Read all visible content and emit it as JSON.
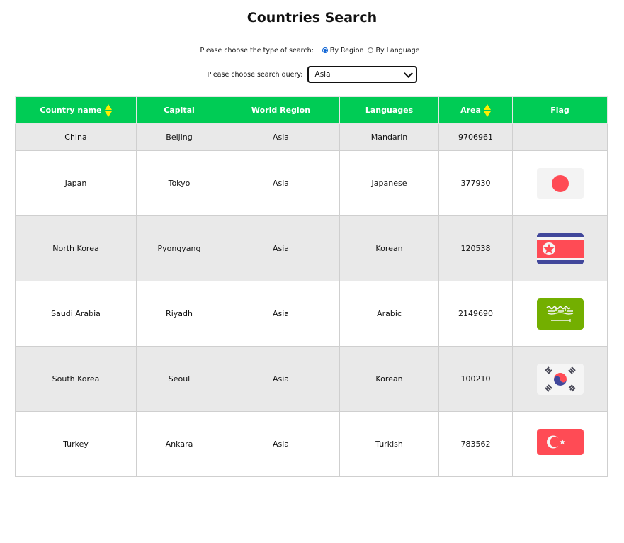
{
  "page": {
    "title": "Countries Search"
  },
  "search_type": {
    "label": "Please choose the type of search:",
    "options": [
      {
        "label": "By Region",
        "selected": true
      },
      {
        "label": "By Language",
        "selected": false
      }
    ]
  },
  "query": {
    "label": "Please choose search query:",
    "value": "Asia"
  },
  "table": {
    "headers": [
      "Country name",
      "Capital",
      "World Region",
      "Languages",
      "Area",
      "Flag"
    ],
    "rows": [
      {
        "country": "China",
        "capital": "Beijing",
        "region": "Asia",
        "language": "Mandarin",
        "area": "9706961",
        "flag": ""
      },
      {
        "country": "Japan",
        "capital": "Tokyo",
        "region": "Asia",
        "language": "Japanese",
        "area": "377930",
        "flag": "japan-flag-icon"
      },
      {
        "country": "North Korea",
        "capital": "Pyongyang",
        "region": "Asia",
        "language": "Korean",
        "area": "120538",
        "flag": "north-korea-flag-icon"
      },
      {
        "country": "Saudi Arabia",
        "capital": "Riyadh",
        "region": "Asia",
        "language": "Arabic",
        "area": "2149690",
        "flag": "saudi-arabia-flag-icon"
      },
      {
        "country": "South Korea",
        "capital": "Seoul",
        "region": "Asia",
        "language": "Korean",
        "area": "100210",
        "flag": "south-korea-flag-icon"
      },
      {
        "country": "Turkey",
        "capital": "Ankara",
        "region": "Asia",
        "language": "Turkish",
        "area": "783562",
        "flag": "turkey-flag-icon"
      }
    ]
  },
  "colors": {
    "header_bg": "#00cc55",
    "sort_arrow": "#ffee00",
    "odd_row": "#e9e9e9",
    "radio_accent": "#0b62d4"
  }
}
